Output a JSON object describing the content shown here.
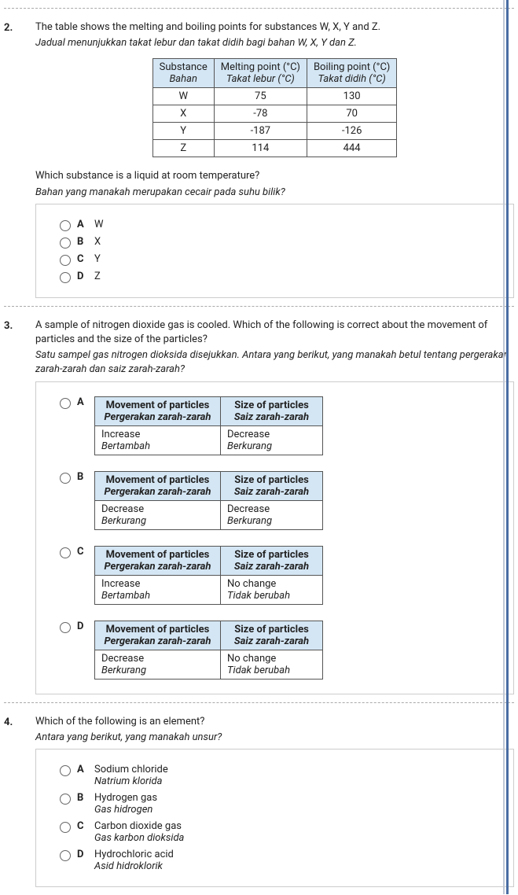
{
  "q2": {
    "num": "2.",
    "text_en": "The table shows the melting and boiling points for substances W, X, Y and Z.",
    "text_ms": "Jadual menunjukkan takat lebur dan takat didih bagi bahan W, X, Y dan Z.",
    "table": {
      "h1_en": "Substance",
      "h1_ms": "Bahan",
      "h2_en": "Melting point (°C)",
      "h2_ms": "Takat lebur (°C)",
      "h3_en": "Boiling point (°C)",
      "h3_ms": "Takat didih (°C)",
      "rows": [
        {
          "s": "W",
          "m": "75",
          "b": "130"
        },
        {
          "s": "X",
          "m": "-78",
          "b": "70"
        },
        {
          "s": "Y",
          "m": "-187",
          "b": "-126"
        },
        {
          "s": "Z",
          "m": "114",
          "b": "444"
        }
      ]
    },
    "ask_en": "Which substance is a liquid at room temperature?",
    "ask_ms": "Bahan yang manakah merupakan cecair pada suhu bilik?",
    "options": [
      {
        "letter": "A",
        "text": "W"
      },
      {
        "letter": "B",
        "text": "X"
      },
      {
        "letter": "C",
        "text": "Y"
      },
      {
        "letter": "D",
        "text": "Z"
      }
    ]
  },
  "q3": {
    "num": "3.",
    "text_en": "A sample of nitrogen dioxide gas is cooled. Which of the following is correct about the movement of particles and the size of the particles?",
    "text_ms": "Satu sampel gas nitrogen dioksida disejukkan. Antara yang berikut, yang manakah betul tentang pergerakan zarah-zarah dan saiz zarah-zarah?",
    "headers": {
      "move_en": "Movement of particles",
      "move_ms": "Pergerakan zarah-zarah",
      "size_en": "Size of particles",
      "size_ms": "Saiz zarah-zarah"
    },
    "options": [
      {
        "letter": "A",
        "move_en": "Increase",
        "move_ms": "Bertambah",
        "size_en": "Decrease",
        "size_ms": "Berkurang"
      },
      {
        "letter": "B",
        "move_en": "Decrease",
        "move_ms": "Berkurang",
        "size_en": "Decrease",
        "size_ms": "Berkurang"
      },
      {
        "letter": "C",
        "move_en": "Increase",
        "move_ms": "Bertambah",
        "size_en": "No change",
        "size_ms": "Tidak berubah"
      },
      {
        "letter": "D",
        "move_en": "Decrease",
        "move_ms": "Berkurang",
        "size_en": "No change",
        "size_ms": "Tidak berubah"
      }
    ]
  },
  "q4": {
    "num": "4.",
    "text_en": "Which of the following is an element?",
    "text_ms": "Antara yang berikut, yang manakah unsur?",
    "options": [
      {
        "letter": "A",
        "en": "Sodium chloride",
        "ms": "Natrium klorida"
      },
      {
        "letter": "B",
        "en": "Hydrogen gas",
        "ms": "Gas hidrogen"
      },
      {
        "letter": "C",
        "en": "Carbon dioxide gas",
        "ms": "Gas karbon dioksida"
      },
      {
        "letter": "D",
        "en": "Hydrochloric acid",
        "ms": "Asid hidroklorik"
      }
    ]
  }
}
